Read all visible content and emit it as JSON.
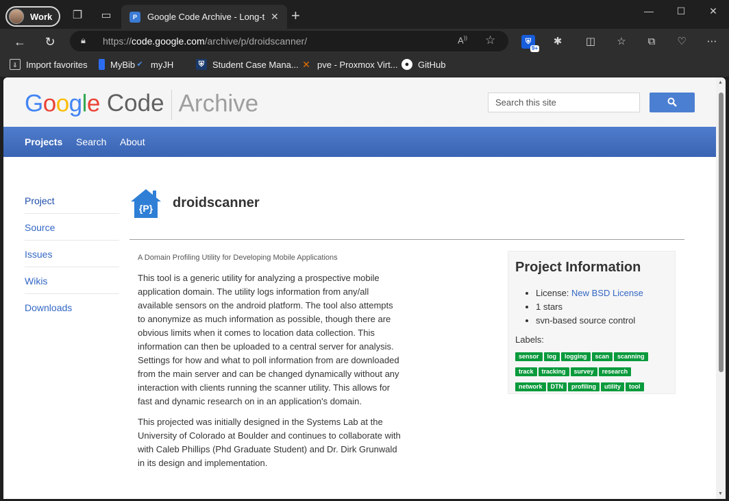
{
  "browser": {
    "profile_label": "Work",
    "tab_title": "Google Code Archive - Long-term",
    "url_prefix": "https://",
    "url_host": "code.google.com",
    "url_path": "/archive/p/droidscanner/",
    "extension_badge": "9+"
  },
  "favorites": [
    {
      "label": "Import favorites"
    },
    {
      "label": "MyBib"
    },
    {
      "label": "myJH"
    },
    {
      "label": "Student Case Mana..."
    },
    {
      "label": "pve - Proxmox Virt..."
    },
    {
      "label": "GitHub"
    }
  ],
  "site": {
    "logo_google": [
      "G",
      "o",
      "o",
      "g",
      "l",
      "e"
    ],
    "logo_code": "Code",
    "logo_archive": "Archive",
    "search_placeholder": "Search this site"
  },
  "nav": {
    "items": [
      "Projects",
      "Search",
      "About"
    ]
  },
  "sidenav": [
    "Project",
    "Source",
    "Issues",
    "Wikis",
    "Downloads"
  ],
  "project": {
    "name": "droidscanner",
    "icon_text": "{P}",
    "summary": "A Domain Profiling Utility for Developing Mobile Applications",
    "description": [
      "This tool is a generic utility for analyzing a prospective mobile application domain. The utility logs information from any/all available sensors on the android platform. The tool also attempts to anonymize as much information as possible, though there are obvious limits when it comes to location data collection. This information can then be uploaded to a central server for analysis. Settings for how and what to poll information from are downloaded from the main server and can be changed dynamically without any interaction with clients running the scanner utility. This allows for fast and dynamic research on in an application's domain.",
      "This projected was initially designed in the Systems Lab at the University of Colorado at Boulder and continues to collaborate with with Caleb Phillips (Phd Graduate Student) and Dr. Dirk Grunwald in its design and implementation."
    ]
  },
  "info": {
    "title": "Project Information",
    "license_prefix": "License: ",
    "license_link": "New BSD License",
    "stars": "1 stars",
    "source_control": "svn-based source control",
    "labels_title": "Labels:",
    "labels": [
      "sensor",
      "log",
      "logging",
      "scan",
      "scanning",
      "track",
      "tracking",
      "survey",
      "research",
      "network",
      "DTN",
      "profiling",
      "utility",
      "tool"
    ]
  },
  "colors": {
    "nav_blue": "#3f6bbd",
    "link_blue": "#3367c4",
    "tag_green": "#0a9a3c"
  }
}
